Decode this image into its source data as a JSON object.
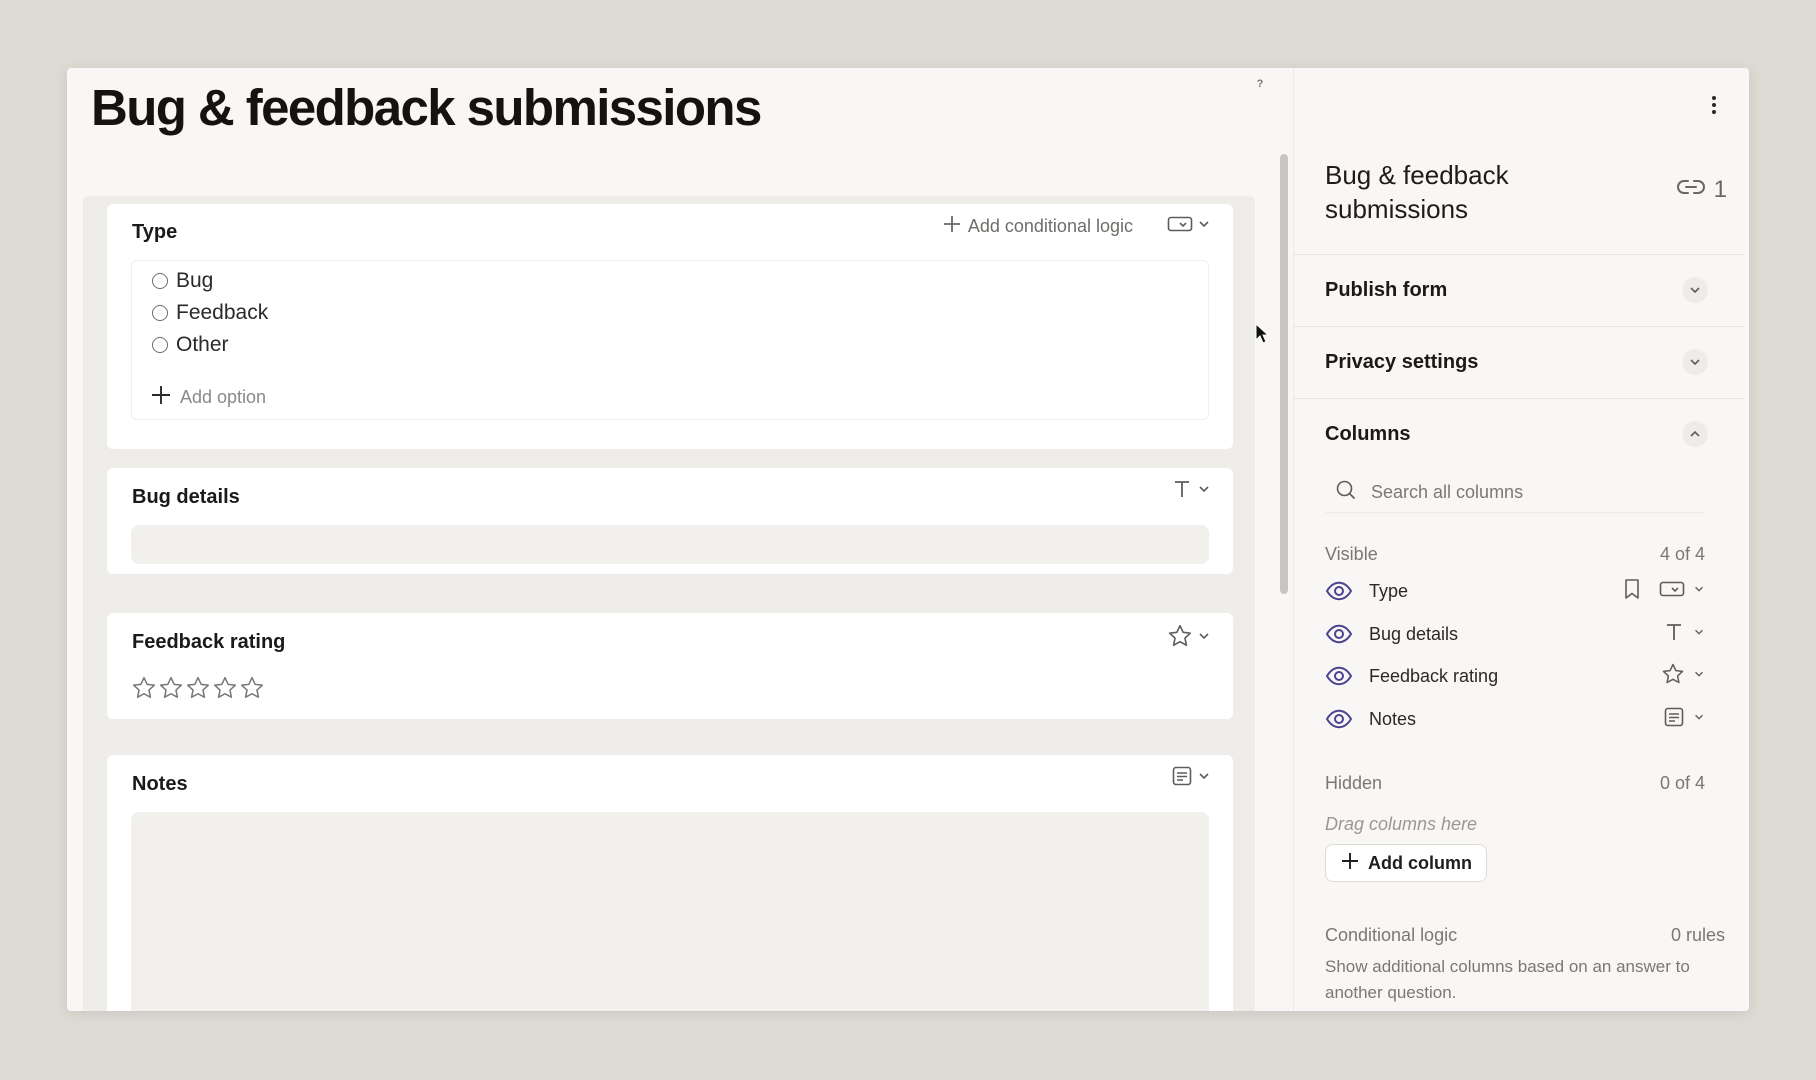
{
  "page": {
    "title": "Bug & feedback submissions",
    "help_label": "?"
  },
  "form": {
    "type_card": {
      "title": "Type",
      "add_conditional_logic": "Add conditional logic",
      "options": [
        "Bug",
        "Feedback",
        "Other"
      ],
      "add_option": "Add option",
      "type_icon": "dropdown-field-icon"
    },
    "bug_card": {
      "title": "Bug details",
      "type_icon": "text-field-icon"
    },
    "rating_card": {
      "title": "Feedback rating",
      "type_icon": "star-icon",
      "rating": 0,
      "max_rating": 5
    },
    "notes_card": {
      "title": "Notes",
      "type_icon": "notes-icon"
    }
  },
  "sidebar": {
    "title": "Bug & feedback submissions",
    "link_count": "1",
    "sections": {
      "publish": "Publish form",
      "privacy": "Privacy settings",
      "columns": "Columns"
    },
    "search_placeholder": "Search all columns",
    "visible": {
      "label": "Visible",
      "count": "4 of 4"
    },
    "columns": [
      {
        "name": "Type",
        "icon": "dropdown-field-icon"
      },
      {
        "name": "Bug details",
        "icon": "text-field-icon"
      },
      {
        "name": "Feedback rating",
        "icon": "star-icon"
      },
      {
        "name": "Notes",
        "icon": "notes-icon"
      }
    ],
    "hidden": {
      "label": "Hidden",
      "count": "0 of 4"
    },
    "drag_hint": "Drag columns here",
    "add_column": "Add column",
    "conditional_logic": {
      "label": "Conditional logic",
      "count": "0 rules",
      "description": "Show additional columns based on an answer to another question."
    },
    "colors": {
      "eye_icon": "#4a4490",
      "accent_text": "#1b1a18"
    }
  }
}
